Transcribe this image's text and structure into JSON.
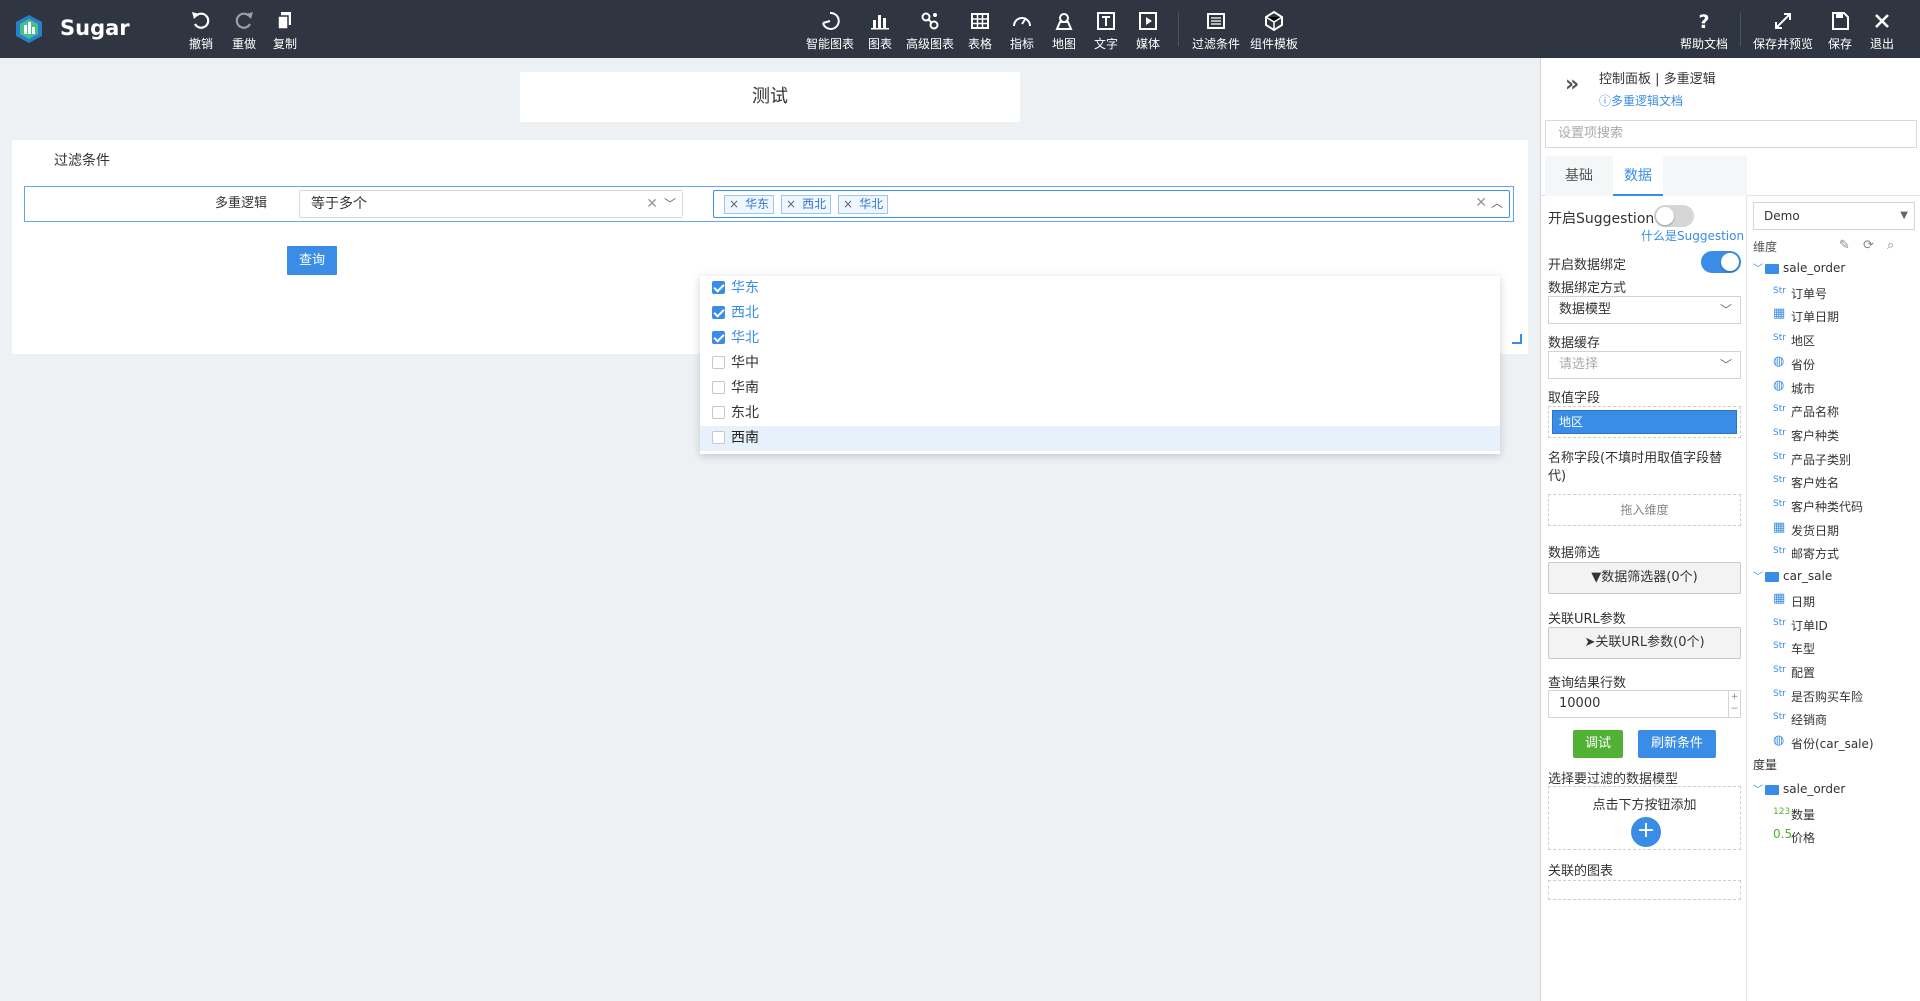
{
  "brand": {
    "name": "Sugar"
  },
  "toolbar": {
    "undo": "撤销",
    "redo": "重做",
    "copy": "复制",
    "center": [
      {
        "label": "智能图表",
        "icon": "smart-chart-icon"
      },
      {
        "label": "图表",
        "icon": "bar-chart-icon"
      },
      {
        "label": "高级图表",
        "icon": "advanced-chart-icon"
      },
      {
        "label": "表格",
        "icon": "table-icon"
      },
      {
        "label": "指标",
        "icon": "gauge-icon"
      },
      {
        "label": "地图",
        "icon": "map-pin-icon"
      },
      {
        "label": "文字",
        "icon": "text-icon"
      },
      {
        "label": "媒体",
        "icon": "media-icon"
      },
      {
        "label": "过滤条件",
        "icon": "filter-icon"
      },
      {
        "label": "组件模板",
        "icon": "template-icon"
      }
    ],
    "help": "帮助文档",
    "save_preview": "保存并预览",
    "save": "保存",
    "exit": "退出"
  },
  "canvas": {
    "title": "测试",
    "filter_panel": {
      "title": "过滤条件",
      "row_label": "多重逻辑",
      "operator": "等于多个",
      "tags": [
        "华东",
        "西北",
        "华北"
      ],
      "query_button": "查询"
    },
    "dropdown": {
      "options": [
        {
          "label": "华东",
          "checked": true
        },
        {
          "label": "西北",
          "checked": true
        },
        {
          "label": "华北",
          "checked": true
        },
        {
          "label": "华中",
          "checked": false
        },
        {
          "label": "华南",
          "checked": false
        },
        {
          "label": "东北",
          "checked": false
        },
        {
          "label": "西南",
          "checked": false
        }
      ]
    }
  },
  "side": {
    "title": "控制面板 | 多重逻辑",
    "doc_link": "多重逻辑文档",
    "search_placeholder": "设置项搜索",
    "tabs": [
      "基础",
      "数据"
    ],
    "suggestion_label": "开启Suggestion",
    "suggestion_link": "什么是Suggestion",
    "suggestion_on": false,
    "binding_label": "开启数据绑定",
    "binding_on": true,
    "binding_mode_label": "数据绑定方式",
    "binding_mode_value": "数据模型",
    "cache_label": "数据缓存",
    "cache_placeholder": "请选择",
    "value_field_label": "取值字段",
    "value_field": "地区",
    "name_field_label": "名称字段(不填时用取值字段替代)",
    "name_field_placeholder": "拖入维度",
    "filter_label": "数据筛选",
    "filter_button": "数据筛选器(0个)",
    "url_label": "关联URL参数",
    "url_button": "关联URL参数(0个)",
    "rows_label": "查询结果行数",
    "rows_value": "10000",
    "debug_button": "调试",
    "refresh_button": "刷新条件",
    "model_label": "选择要过滤的数据模型",
    "model_hint": "点击下方按钮添加",
    "linked_label": "关联的图表",
    "colors": {
      "accent": "#3a8de6",
      "green": "#52b035"
    }
  },
  "fields": {
    "source": "Demo",
    "dim_header": "维度",
    "measure_header": "度量",
    "dimensions": [
      {
        "type": "folder",
        "label": "sale_order"
      },
      {
        "type": "Str",
        "label": "订单号"
      },
      {
        "type": "date",
        "label": "订单日期"
      },
      {
        "type": "Str",
        "label": "地区"
      },
      {
        "type": "geo",
        "label": "省份"
      },
      {
        "type": "geo",
        "label": "城市"
      },
      {
        "type": "Str",
        "label": "产品名称"
      },
      {
        "type": "Str",
        "label": "客户种类"
      },
      {
        "type": "Str",
        "label": "产品子类别"
      },
      {
        "type": "Str",
        "label": "客户姓名"
      },
      {
        "type": "Str",
        "label": "客户种类代码"
      },
      {
        "type": "date",
        "label": "发货日期"
      },
      {
        "type": "Str",
        "label": "邮寄方式"
      },
      {
        "type": "folder",
        "label": "car_sale"
      },
      {
        "type": "date",
        "label": "日期"
      },
      {
        "type": "Str",
        "label": "订单ID"
      },
      {
        "type": "Str",
        "label": "车型"
      },
      {
        "type": "Str",
        "label": "配置"
      },
      {
        "type": "Str",
        "label": "是否购买车险"
      },
      {
        "type": "Str",
        "label": "经销商"
      },
      {
        "type": "geo",
        "label": "省份(car_sale)"
      }
    ],
    "measures": [
      {
        "type": "folder",
        "label": "sale_order"
      },
      {
        "type": "123",
        "label": "数量"
      },
      {
        "type": "0.5",
        "label": "价格"
      }
    ]
  }
}
